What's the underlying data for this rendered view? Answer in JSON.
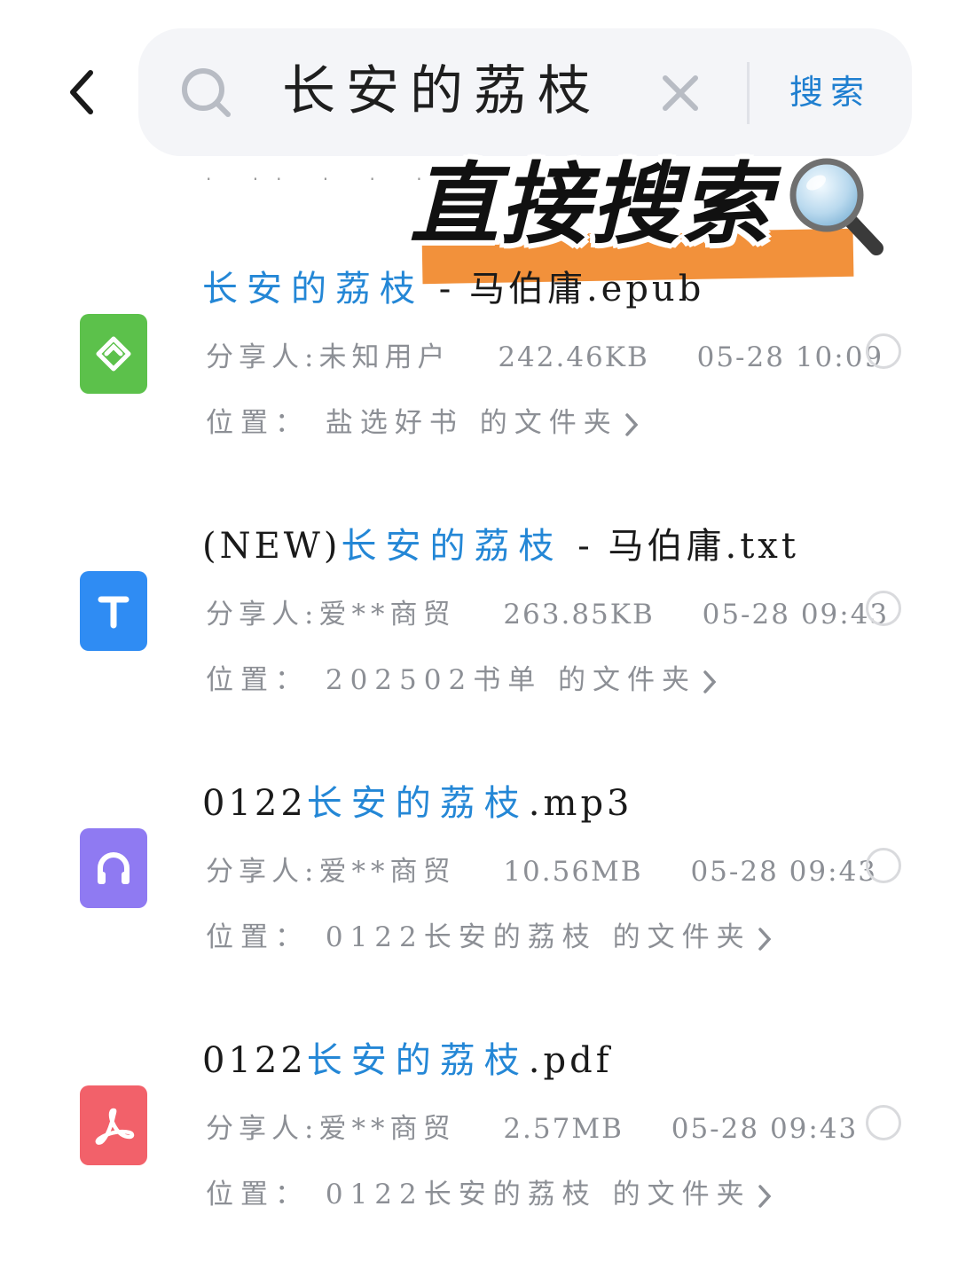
{
  "header": {
    "back_icon": "chevron-left-icon",
    "search": {
      "query": "长安的荔枝",
      "submit_label": "搜索",
      "icon": "search-icon",
      "clear_icon": "close-icon"
    }
  },
  "overlay": {
    "caption": "直接搜索",
    "icon": "magnifier-icon",
    "highlight_color": "#f2913b"
  },
  "colors": {
    "accent": "#2487d6",
    "meta": "#8c8f95"
  },
  "files": [
    {
      "type": "epub",
      "icon": "epub-icon",
      "icon_color": "#5cc14b",
      "name_prefix": "",
      "name_highlight": "长安的荔枝",
      "name_suffix": " - 马伯庸.epub",
      "sharer": "分享人:未知用户",
      "size": "242.46KB",
      "time": "05-28 10:09",
      "location": "位置： 盐选好书 的文件夹"
    },
    {
      "type": "txt",
      "icon": "text-file-icon",
      "icon_color": "#2f8cf3",
      "name_prefix": "(NEW)",
      "name_highlight": "长安的荔枝",
      "name_suffix": " - 马伯庸.txt",
      "sharer": "分享人:爱**商贸",
      "size": "263.85KB",
      "time": "05-28 09:43",
      "location": "位置： 202502书单 的文件夹"
    },
    {
      "type": "mp3",
      "icon": "headphones-icon",
      "icon_color": "#8f7af2",
      "name_prefix": "0122",
      "name_highlight": "长安的荔枝",
      "name_suffix": ".mp3",
      "sharer": "分享人:爱**商贸",
      "size": "10.56MB",
      "time": "05-28 09:43",
      "location": "位置： 0122长安的荔枝 的文件夹"
    },
    {
      "type": "pdf",
      "icon": "pdf-icon",
      "icon_color": "#f2616a",
      "name_prefix": "0122",
      "name_highlight": "长安的荔枝",
      "name_suffix": ".pdf",
      "sharer": "分享人:爱**商贸",
      "size": "2.57MB",
      "time": "05-28 09:43",
      "location": "位置： 0122长安的荔枝 的文件夹"
    }
  ]
}
